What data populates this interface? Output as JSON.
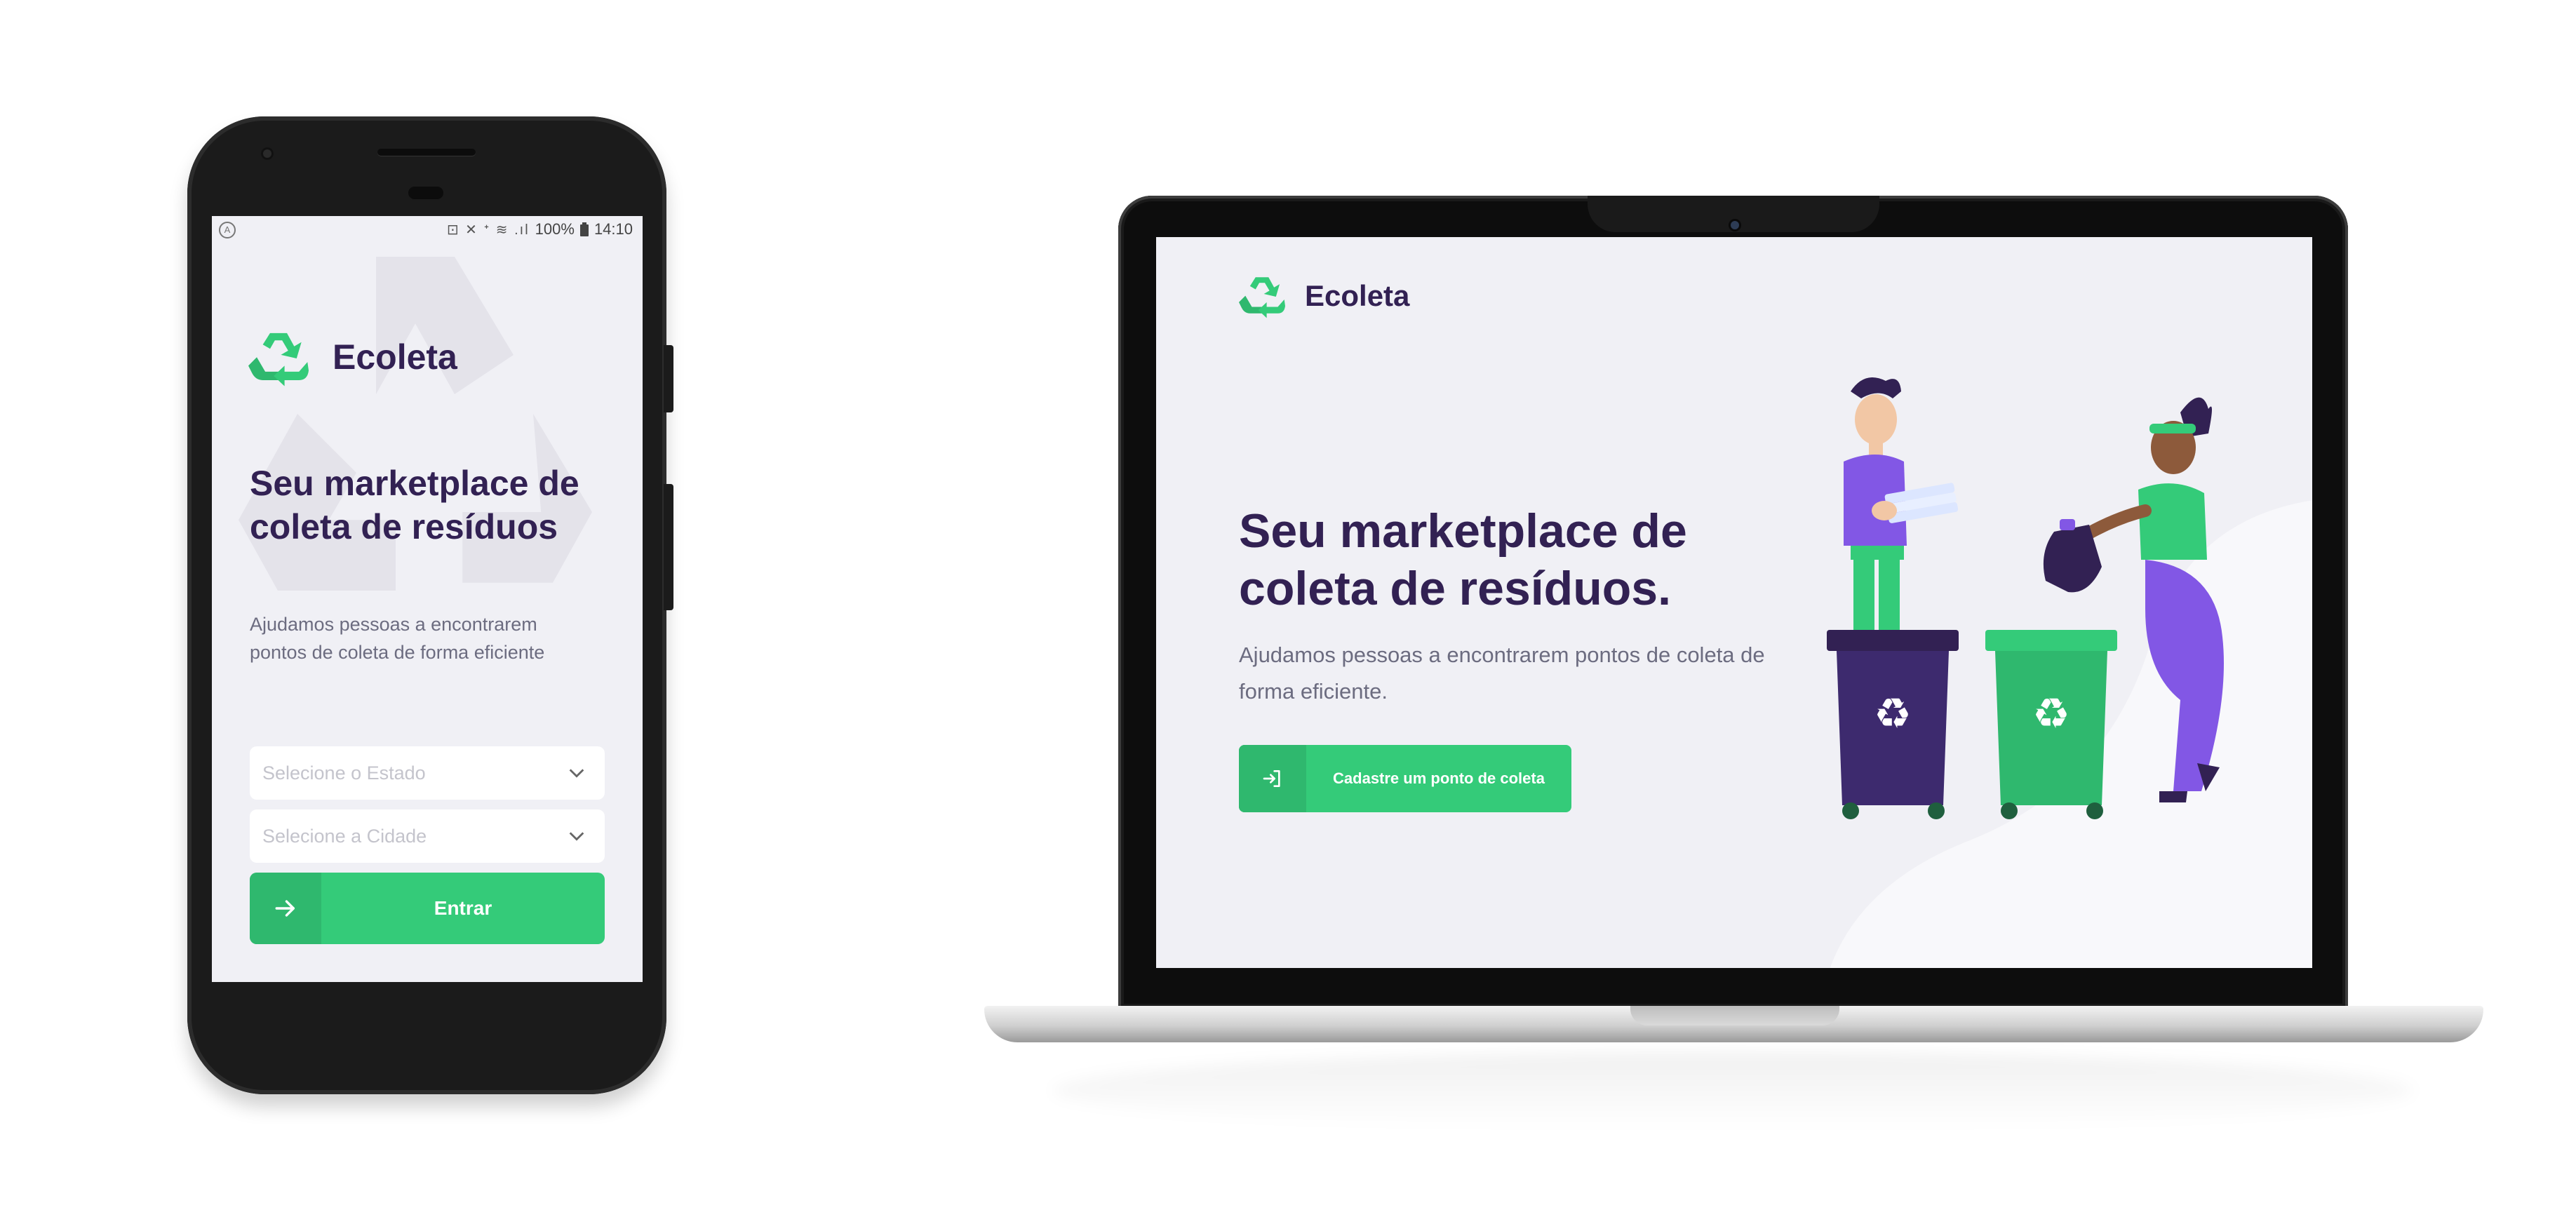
{
  "mobile": {
    "status_bar": {
      "battery_percent": "100%",
      "time": "14:10",
      "indicators": "⊡ ✕ ᐩ ≋ .ıl"
    },
    "logo_text": "Ecoleta",
    "title": "Seu marketplace de coleta de resíduos",
    "description": "Ajudamos pessoas a encontrarem pontos de coleta de forma eficiente",
    "state_select": {
      "placeholder": "Selecione o Estado"
    },
    "city_select": {
      "placeholder": "Selecione a Cidade"
    },
    "enter_label": "Entrar"
  },
  "desktop": {
    "logo_text": "Ecoleta",
    "title": "Seu marketplace de coleta de resíduos.",
    "description": "Ajudamos pessoas a encontrarem pontos de coleta de forma eficiente.",
    "cta_label": "Cadastre um ponto de coleta"
  },
  "colors": {
    "primary": "#34cb79",
    "primary_dark": "#2fb86e",
    "title": "#322153",
    "text": "#6c6c80",
    "background": "#f0f0f5"
  },
  "icons": [
    "recycle-icon",
    "chevron-down-icon",
    "arrow-right-icon",
    "log-in-icon"
  ]
}
